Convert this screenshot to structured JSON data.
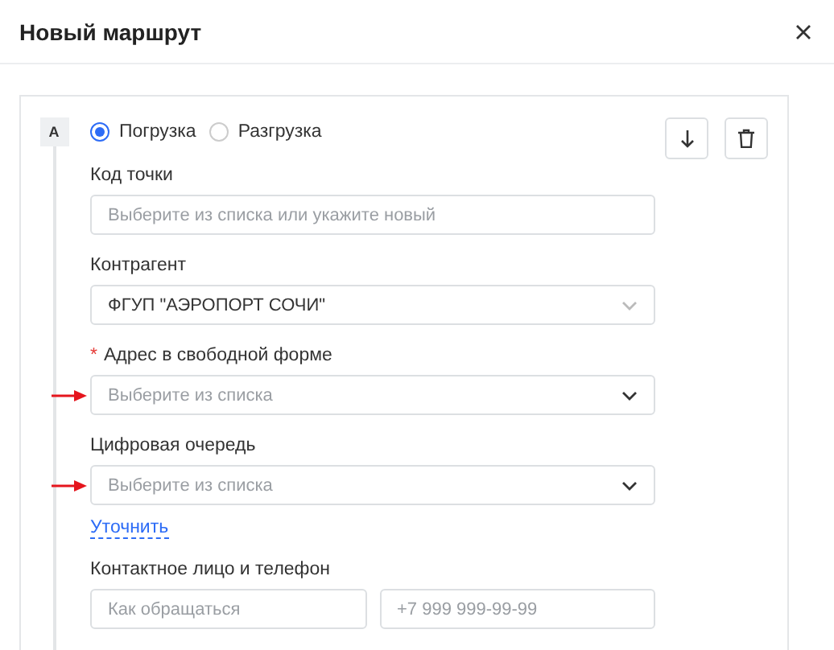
{
  "dialog": {
    "title": "Новый маршрут"
  },
  "point": {
    "badge": "A",
    "operations": [
      {
        "label": "Погрузка",
        "selected": true
      },
      {
        "label": "Разгрузка",
        "selected": false
      }
    ],
    "fields": [
      {
        "kind": "input",
        "label": "Код точки",
        "marked": false,
        "placeholder": "Выберите из списка или укажите новый"
      },
      {
        "kind": "select",
        "label": "Контрагент",
        "marked": false,
        "value": "ФГУП \"АЭРОПОРТ СОЧИ\""
      },
      {
        "kind": "select",
        "label": "Адрес в свободной форме",
        "required_mark": "*",
        "marked": true,
        "placeholder": "Выберите из списка"
      },
      {
        "kind": "select",
        "label": "Цифровая очередь",
        "marked": true,
        "placeholder": "Выберите из списка"
      }
    ],
    "clarify_link": "Уточнить",
    "contact": {
      "label": "Контактное лицо и телефон",
      "name_placeholder": "Как обращаться",
      "phone_placeholder": "+7 999 999-99-99"
    }
  }
}
